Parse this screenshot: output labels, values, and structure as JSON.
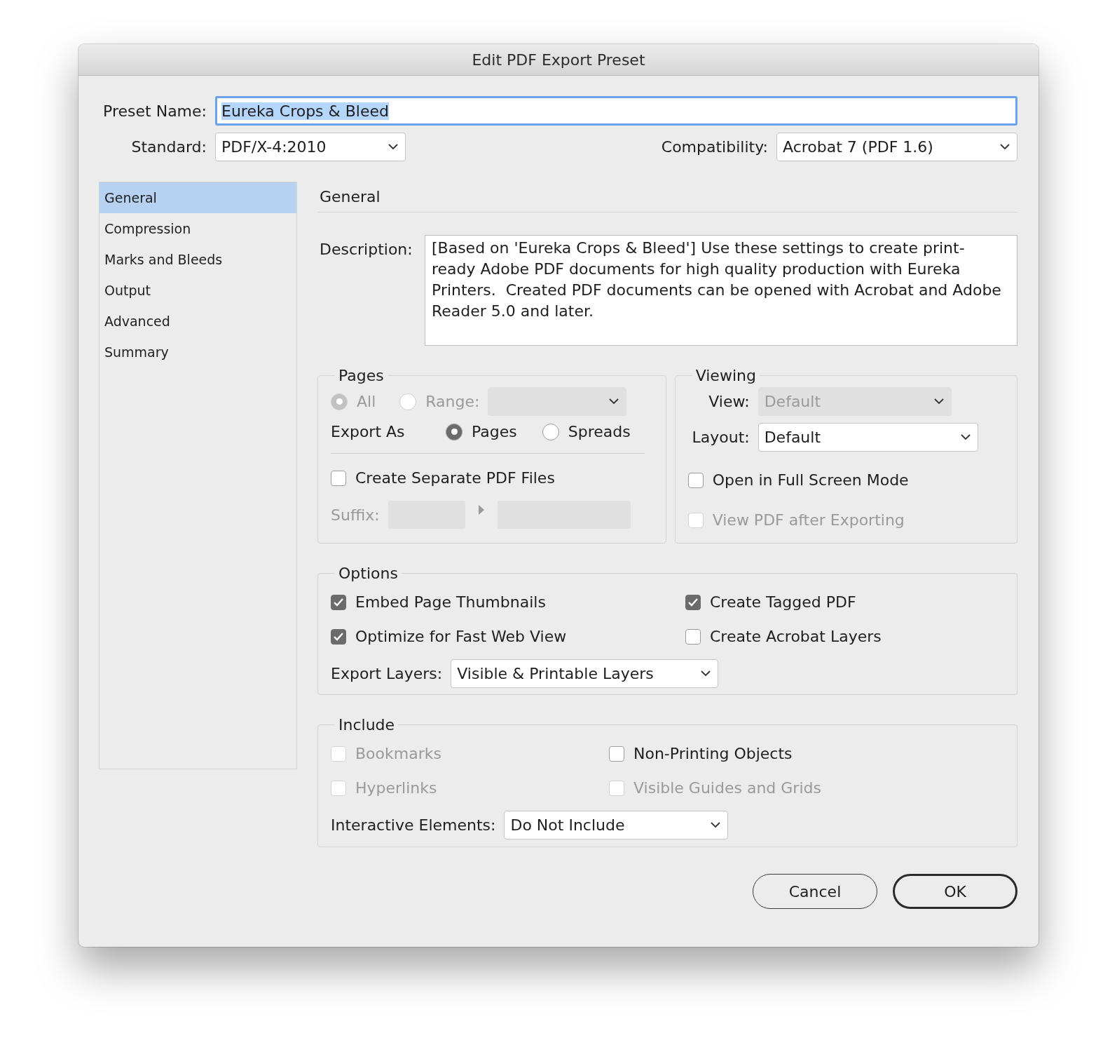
{
  "window": {
    "title": "Edit PDF Export Preset"
  },
  "preset_name": {
    "label": "Preset Name:",
    "value": "Eureka Crops & Bleed",
    "selected": true
  },
  "standard": {
    "label": "Standard:",
    "value": "PDF/X-4:2010"
  },
  "compatibility": {
    "label": "Compatibility:",
    "value": "Acrobat 7 (PDF 1.6)"
  },
  "sidebar": {
    "items": [
      {
        "label": "General",
        "selected": true
      },
      {
        "label": "Compression",
        "selected": false
      },
      {
        "label": "Marks and Bleeds",
        "selected": false
      },
      {
        "label": "Output",
        "selected": false
      },
      {
        "label": "Advanced",
        "selected": false
      },
      {
        "label": "Summary",
        "selected": false
      }
    ]
  },
  "section_title": "General",
  "description": {
    "label": "Description:",
    "value": "[Based on 'Eureka Crops & Bleed'] Use these settings to create print-ready Adobe PDF documents for high quality production with Eureka Printers.  Created PDF documents can be opened with Acrobat and Adobe Reader 5.0 and later."
  },
  "pages": {
    "title": "Pages",
    "range_options": [
      {
        "label": "All",
        "selected": true,
        "disabled": true
      },
      {
        "label": "Range:",
        "selected": false,
        "disabled": true
      }
    ],
    "range_dropdown": {
      "disabled": true
    },
    "export_as": {
      "label": "Export As",
      "options": [
        {
          "label": "Pages",
          "selected": true
        },
        {
          "label": "Spreads",
          "selected": false
        }
      ]
    },
    "create_separate": {
      "label": "Create Separate PDF Files",
      "checked": false
    },
    "suffix": {
      "label": "Suffix:",
      "disabled": true
    }
  },
  "viewing": {
    "title": "Viewing",
    "view": {
      "label": "View:",
      "value": "Default",
      "disabled": true
    },
    "layout": {
      "label": "Layout:",
      "value": "Default",
      "disabled": false
    },
    "checkboxes": [
      {
        "label": "Open in Full Screen Mode",
        "checked": false,
        "disabled": false
      },
      {
        "label": "View PDF after Exporting",
        "checked": false,
        "disabled": true
      }
    ]
  },
  "options": {
    "title": "Options",
    "checkboxes": [
      {
        "label": "Embed Page Thumbnails",
        "checked": true,
        "disabled": false
      },
      {
        "label": "Create Tagged PDF",
        "checked": true,
        "disabled": false
      },
      {
        "label": "Optimize for Fast Web View",
        "checked": true,
        "disabled": false
      },
      {
        "label": "Create Acrobat Layers",
        "checked": false,
        "disabled": false
      }
    ],
    "export_layers": {
      "label": "Export Layers:",
      "value": "Visible & Printable Layers"
    }
  },
  "include": {
    "title": "Include",
    "checkboxes": [
      {
        "label": "Bookmarks",
        "checked": false,
        "disabled": true
      },
      {
        "label": "Non-Printing Objects",
        "checked": false,
        "disabled": false
      },
      {
        "label": "Hyperlinks",
        "checked": false,
        "disabled": true
      },
      {
        "label": "Visible Guides and Grids",
        "checked": false,
        "disabled": true
      }
    ],
    "interactive_elements": {
      "label": "Interactive Elements:",
      "value": "Do Not Include"
    }
  },
  "buttons": [
    {
      "label": "Cancel",
      "default": false
    },
    {
      "label": "OK",
      "default": true
    }
  ]
}
